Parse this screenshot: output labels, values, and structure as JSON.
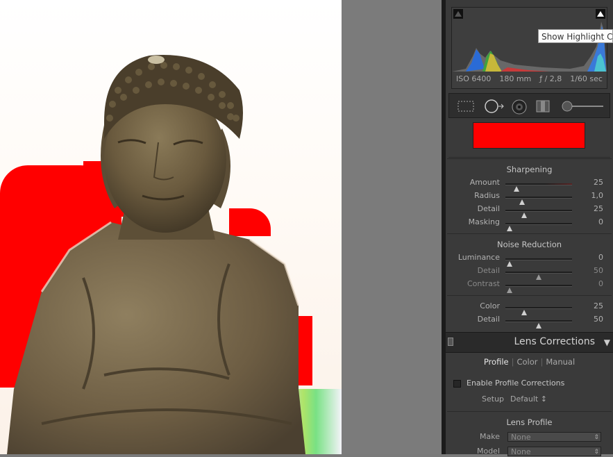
{
  "histogram": {
    "tooltip": "Show Highlight Clipping",
    "exif": {
      "iso": "ISO 6400",
      "focal": "180 mm",
      "aperture": "ƒ / 2,8",
      "shutter": "1/60 sec"
    }
  },
  "detail": {
    "sharpening": {
      "title": "Sharpening",
      "sliders": [
        {
          "label": "Amount",
          "value": "25",
          "fraction": 0.17
        },
        {
          "label": "Radius",
          "value": "1,0",
          "fraction": 0.25
        },
        {
          "label": "Detail",
          "value": "25",
          "fraction": 0.28
        },
        {
          "label": "Masking",
          "value": "0",
          "fraction": 0.06
        }
      ]
    },
    "noise_reduction": {
      "title": "Noise Reduction",
      "sliders": [
        {
          "label": "Luminance",
          "value": "0",
          "fraction": 0.06
        },
        {
          "label": "Detail",
          "value": "50",
          "fraction": 0.5
        },
        {
          "label": "Contrast",
          "value": "0",
          "fraction": 0.06
        }
      ],
      "color_sliders": [
        {
          "label": "Color",
          "value": "25",
          "fraction": 0.28
        },
        {
          "label": "Detail",
          "value": "50",
          "fraction": 0.5
        }
      ]
    }
  },
  "lens_corrections": {
    "title": "Lens Corrections",
    "tabs": [
      "Profile",
      "Color",
      "Manual"
    ],
    "active_tab": "Profile",
    "enable_label": "Enable Profile Corrections",
    "setup_label": "Setup",
    "setup_value": "Default ↕",
    "lens_profile_title": "Lens Profile",
    "make_label": "Make",
    "make_value": "None",
    "model_label": "Model",
    "model_value": "None"
  },
  "colors": {
    "clipping_highlight": "#ff0000",
    "panel_bg": "#3a3a3a"
  }
}
